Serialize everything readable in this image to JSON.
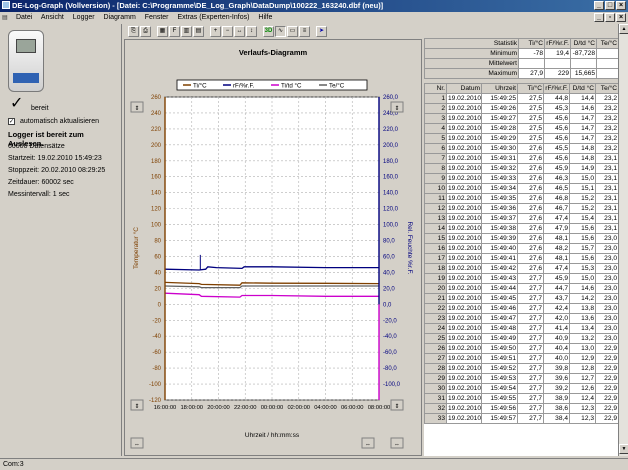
{
  "window": {
    "title": "DE-Log-Graph (Vollversion) - [Datei: C:\\Programme\\DE_Log_Graph\\DataDump\\100222_163240.dbf (neu)]",
    "menu": [
      "Datei",
      "Ansicht",
      "Logger",
      "Diagramm",
      "Fenster",
      "Extras (Experten-Infos)",
      "Hilfe"
    ]
  },
  "left": {
    "ready_label": "bereit",
    "auto_update_label": "automatisch aktualisieren",
    "status": "Logger ist bereit zum Auslesen.",
    "info": [
      "60000 Datensätze",
      "Startzeit: 19.02.2010 15:49:23",
      "Stoppzeit: 20.02.2010 08:29:25",
      "Zeitdauer: 60002 sec",
      "Messintervall: 1 sec"
    ]
  },
  "chart_data": {
    "type": "line",
    "title": "Verlaufs-Diagramm",
    "xlabel": "Uhrzeit / hh:mm:ss",
    "ylabel": "Temperatur °C",
    "y2label": "Rel. Feuchte %r.F.",
    "x_ticks": [
      "16:00:00",
      "18:00:00",
      "20:00:00",
      "22:00:00",
      "00:00:00",
      "02:00:00",
      "04:00:00",
      "06:00:00",
      "08:00:00"
    ],
    "ylim": [
      -120,
      260
    ],
    "y2lim": [
      -120,
      260
    ],
    "y_ticks": [
      260,
      240,
      220,
      200,
      180,
      160,
      140,
      120,
      100,
      80,
      60,
      40,
      20,
      0,
      -20,
      -40,
      -60,
      -80,
      -100,
      -120
    ],
    "y2_ticks": [
      "260,0",
      "240,0",
      "220,0",
      "200,0",
      "180,0",
      "160,0",
      "140,0",
      "120,0",
      "100,0",
      "80,0",
      "60,0",
      "40,0",
      "20,0",
      "0,0",
      "-20,0",
      "-40,0",
      "-60,0",
      "-80,0",
      "-100,0"
    ],
    "legend": [
      "Ti/°C",
      "rF/%r.F.",
      "Ti/td °C",
      "Te/°C"
    ],
    "series": [
      {
        "name": "rF/%r.F.",
        "color": "#00007f",
        "x": [
          0,
          0.16,
          0.19,
          0.2,
          0.24,
          0.36,
          0.37,
          0.5,
          0.75,
          1.0
        ],
        "values": [
          44,
          43,
          44,
          47,
          46,
          45,
          47,
          47,
          46,
          46
        ]
      },
      {
        "name": "Ti/°C",
        "color": "#7f4000",
        "x": [
          0,
          0.16,
          0.17,
          0.35,
          0.36,
          0.5,
          0.75,
          1.0
        ],
        "values": [
          27.5,
          26,
          25,
          24,
          27,
          26.5,
          26.3,
          26
        ]
      },
      {
        "name": "Te/°C",
        "color": "#606060",
        "x": [
          0,
          0.16,
          0.17,
          0.35,
          0.36,
          0.5,
          0.75,
          1.0
        ],
        "values": [
          23,
          22,
          21,
          21,
          23,
          23,
          23,
          23
        ]
      },
      {
        "name": "Ti/td °C",
        "color": "#cc00cc",
        "x": [
          0,
          0.16,
          0.17,
          0.35,
          0.36,
          0.5,
          0.75,
          1.0
        ],
        "values": [
          14,
          12,
          10,
          9,
          11,
          11,
          10,
          10
        ]
      }
    ]
  },
  "stats": {
    "headers": [
      "Statistik",
      "Ti/°C",
      "rF/%r.F.",
      "D/td °C",
      "Te/°C"
    ],
    "rows": [
      {
        "label": "Minimum",
        "values": [
          "-78",
          "19,4",
          "-87,728",
          ""
        ]
      },
      {
        "label": "Mittelwert",
        "values": [
          "",
          "",
          "",
          ""
        ]
      },
      {
        "label": "Maximum",
        "values": [
          "27,9",
          "229",
          "15,665",
          ""
        ]
      }
    ]
  },
  "table": {
    "headers": [
      "Nr.",
      "Datum",
      "Uhrzeit",
      "Ti/°C",
      "rF/%r.F.",
      "D/td °C",
      "Te/°C"
    ],
    "rows": [
      [
        "1",
        "19.02.2010",
        "15:49:25",
        "27,5",
        "44,8",
        "14,4",
        "23,2"
      ],
      [
        "2",
        "19.02.2010",
        "15:49:26",
        "27,5",
        "45,3",
        "14,6",
        "23,2"
      ],
      [
        "3",
        "19.02.2010",
        "15:49:27",
        "27,5",
        "45,6",
        "14,7",
        "23,2"
      ],
      [
        "4",
        "19.02.2010",
        "15:49:28",
        "27,5",
        "45,6",
        "14,7",
        "23,2"
      ],
      [
        "5",
        "19.02.2010",
        "15:49:29",
        "27,5",
        "45,6",
        "14,7",
        "23,2"
      ],
      [
        "6",
        "19.02.2010",
        "15:49:30",
        "27,6",
        "45,5",
        "14,8",
        "23,2"
      ],
      [
        "7",
        "19.02.2010",
        "15:49:31",
        "27,6",
        "45,6",
        "14,8",
        "23,1"
      ],
      [
        "8",
        "19.02.2010",
        "15:49:32",
        "27,6",
        "45,9",
        "14,9",
        "23,1"
      ],
      [
        "9",
        "19.02.2010",
        "15:49:33",
        "27,6",
        "46,3",
        "15,0",
        "23,1"
      ],
      [
        "10",
        "19.02.2010",
        "15:49:34",
        "27,6",
        "46,5",
        "15,1",
        "23,1"
      ],
      [
        "11",
        "19.02.2010",
        "15:49:35",
        "27,6",
        "46,8",
        "15,2",
        "23,1"
      ],
      [
        "12",
        "19.02.2010",
        "15:49:36",
        "27,6",
        "46,7",
        "15,2",
        "23,1"
      ],
      [
        "13",
        "19.02.2010",
        "15:49:37",
        "27,6",
        "47,4",
        "15,4",
        "23,1"
      ],
      [
        "14",
        "19.02.2010",
        "15:49:38",
        "27,6",
        "47,9",
        "15,6",
        "23,1"
      ],
      [
        "15",
        "19.02.2010",
        "15:49:39",
        "27,6",
        "48,1",
        "15,6",
        "23,0"
      ],
      [
        "16",
        "19.02.2010",
        "15:49:40",
        "27,6",
        "48,2",
        "15,7",
        "23,0"
      ],
      [
        "17",
        "19.02.2010",
        "15:49:41",
        "27,6",
        "48,1",
        "15,6",
        "23,0"
      ],
      [
        "18",
        "19.02.2010",
        "15:49:42",
        "27,6",
        "47,4",
        "15,3",
        "23,0"
      ],
      [
        "19",
        "19.02.2010",
        "15:49:43",
        "27,7",
        "45,9",
        "15,0",
        "23,0"
      ],
      [
        "20",
        "19.02.2010",
        "15:49:44",
        "27,7",
        "44,7",
        "14,6",
        "23,0"
      ],
      [
        "21",
        "19.02.2010",
        "15:49:45",
        "27,7",
        "43,7",
        "14,2",
        "23,0"
      ],
      [
        "22",
        "19.02.2010",
        "15:49:46",
        "27,7",
        "42,4",
        "13,8",
        "23,0"
      ],
      [
        "23",
        "19.02.2010",
        "15:49:47",
        "27,7",
        "42,0",
        "13,6",
        "23,0"
      ],
      [
        "24",
        "19.02.2010",
        "15:49:48",
        "27,7",
        "41,4",
        "13,4",
        "23,0"
      ],
      [
        "25",
        "19.02.2010",
        "15:49:49",
        "27,7",
        "40,9",
        "13,2",
        "23,0"
      ],
      [
        "26",
        "19.02.2010",
        "15:49:50",
        "27,7",
        "40,4",
        "13,0",
        "22,9"
      ],
      [
        "27",
        "19.02.2010",
        "15:49:51",
        "27,7",
        "40,0",
        "12,9",
        "22,9"
      ],
      [
        "28",
        "19.02.2010",
        "15:49:52",
        "27,7",
        "39,8",
        "12,8",
        "22,9"
      ],
      [
        "29",
        "19.02.2010",
        "15:49:53",
        "27,7",
        "39,6",
        "12,7",
        "22,9"
      ],
      [
        "30",
        "19.02.2010",
        "15:49:54",
        "27,7",
        "39,2",
        "12,6",
        "22,9"
      ],
      [
        "31",
        "19.02.2010",
        "15:49:55",
        "27,7",
        "38,9",
        "12,4",
        "22,9"
      ],
      [
        "32",
        "19.02.2010",
        "15:49:56",
        "27,7",
        "38,6",
        "12,3",
        "22,9"
      ],
      [
        "33",
        "19.02.2010",
        "15:49:57",
        "27,7",
        "38,4",
        "12,3",
        "22,9"
      ]
    ]
  },
  "statusbar": {
    "port": "Com:3"
  }
}
